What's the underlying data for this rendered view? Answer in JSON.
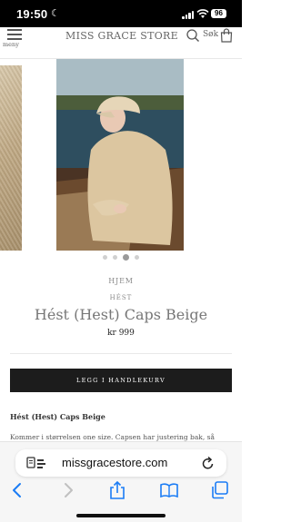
{
  "status_bar": {
    "time": "19:50",
    "battery": "96"
  },
  "header": {
    "menu_label": "meny",
    "store_title": "MISS GRACE STORE",
    "search_label": "Søk"
  },
  "gallery": {
    "slide_count": 4,
    "active_index": 2
  },
  "product": {
    "breadcrumb_home": "HJEM",
    "brand": "HÉST",
    "title": "Hést (Hest) Caps Beige",
    "price": "kr 999",
    "add_to_cart_label": "LEGG I HANDLEKURV",
    "description_title": "Hést (Hest) Caps Beige",
    "description_text": "Kommer i størrelsen one size. Capsen har justering bak, så"
  },
  "browser": {
    "url": "missgracestore.com"
  },
  "colors": {
    "button": "#1c1c1c",
    "accent": "#1a7cf5",
    "text_muted": "#777777"
  }
}
